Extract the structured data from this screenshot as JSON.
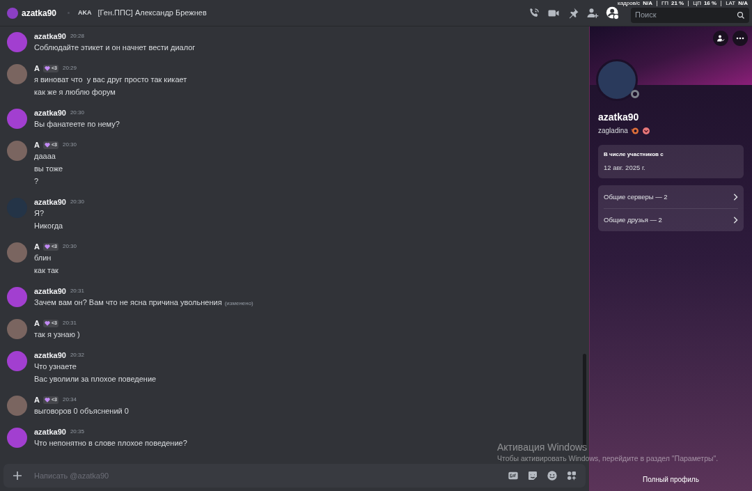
{
  "header": {
    "username": "azatka90",
    "aka_label": "AKA",
    "aka_name": "[Ген.ППС] Александр Брежнев",
    "search": {
      "placeholder": "Поиск"
    }
  },
  "perf_overlay": [
    {
      "label": "кадров/с",
      "value": "N/A"
    },
    {
      "label": "ГП",
      "value": "21 %"
    },
    {
      "label": "ЦП",
      "value": "16 %"
    },
    {
      "label": "LAT",
      "value": "N/A"
    }
  ],
  "messages": [
    {
      "color": "#a23fd0",
      "author": "azatka90",
      "time": "20:28",
      "lines": [
        "Соблюдайте этикет и он начнет вести диалог"
      ]
    },
    {
      "color": "#7a6560",
      "author": "A",
      "tag": "<3",
      "time": "20:29",
      "lines": [
        "я виноват что  у вас друг просто так кикает",
        "как же я люблю форум"
      ]
    },
    {
      "color": "#a23fd0",
      "author": "azatka90",
      "time": "20:30",
      "lines": [
        "Вы фанатеете по нему?"
      ]
    },
    {
      "color": "#7a6560",
      "author": "A",
      "tag": "<3",
      "time": "20:30",
      "lines": [
        "даааа",
        "вы тоже",
        "?"
      ]
    },
    {
      "color": "#243447",
      "author": "azatka90",
      "time": "20:30",
      "lines": [
        "Я?",
        "Никогда"
      ]
    },
    {
      "color": "#7a6560",
      "author": "A",
      "tag": "<3",
      "time": "20:30",
      "lines": [
        "блин",
        "как так"
      ]
    },
    {
      "color": "#a23fd0",
      "author": "azatka90",
      "time": "20:31",
      "lines": [
        "Зачем вам он? Вам что не ясна причина увольнения"
      ],
      "edited_label": "(изменено)"
    },
    {
      "color": "#7a6560",
      "author": "A",
      "tag": "<3",
      "time": "20:31",
      "lines": [
        "так я узнаю )"
      ]
    },
    {
      "color": "#a23fd0",
      "author": "azatka90",
      "time": "20:32",
      "lines": [
        "Что узнаете",
        "Вас уволили за плохое поведение"
      ]
    },
    {
      "color": "#7a6560",
      "author": "A",
      "tag": "<3",
      "time": "20:34",
      "lines": [
        "выговоров 0 объяснений 0"
      ]
    },
    {
      "color": "#a23fd0",
      "author": "azatka90",
      "time": "20:35",
      "lines": [
        "Что непонятно в слове плохое поведение?"
      ]
    }
  ],
  "composer": {
    "placeholder": "Написать @azatka90"
  },
  "profile": {
    "display_name": "azatka90",
    "username": "zagladina",
    "member_since_label": "В числе участников с",
    "member_since": "12 авг. 2025 г.",
    "links": [
      "Общие серверы — 2",
      "Общие друзья — 2"
    ],
    "full_profile": "Полный профиль"
  },
  "os_notice": {
    "title": "Активация Windows",
    "text": "Чтобы активировать Windows, перейдите в раздел \"Параметры\"."
  }
}
